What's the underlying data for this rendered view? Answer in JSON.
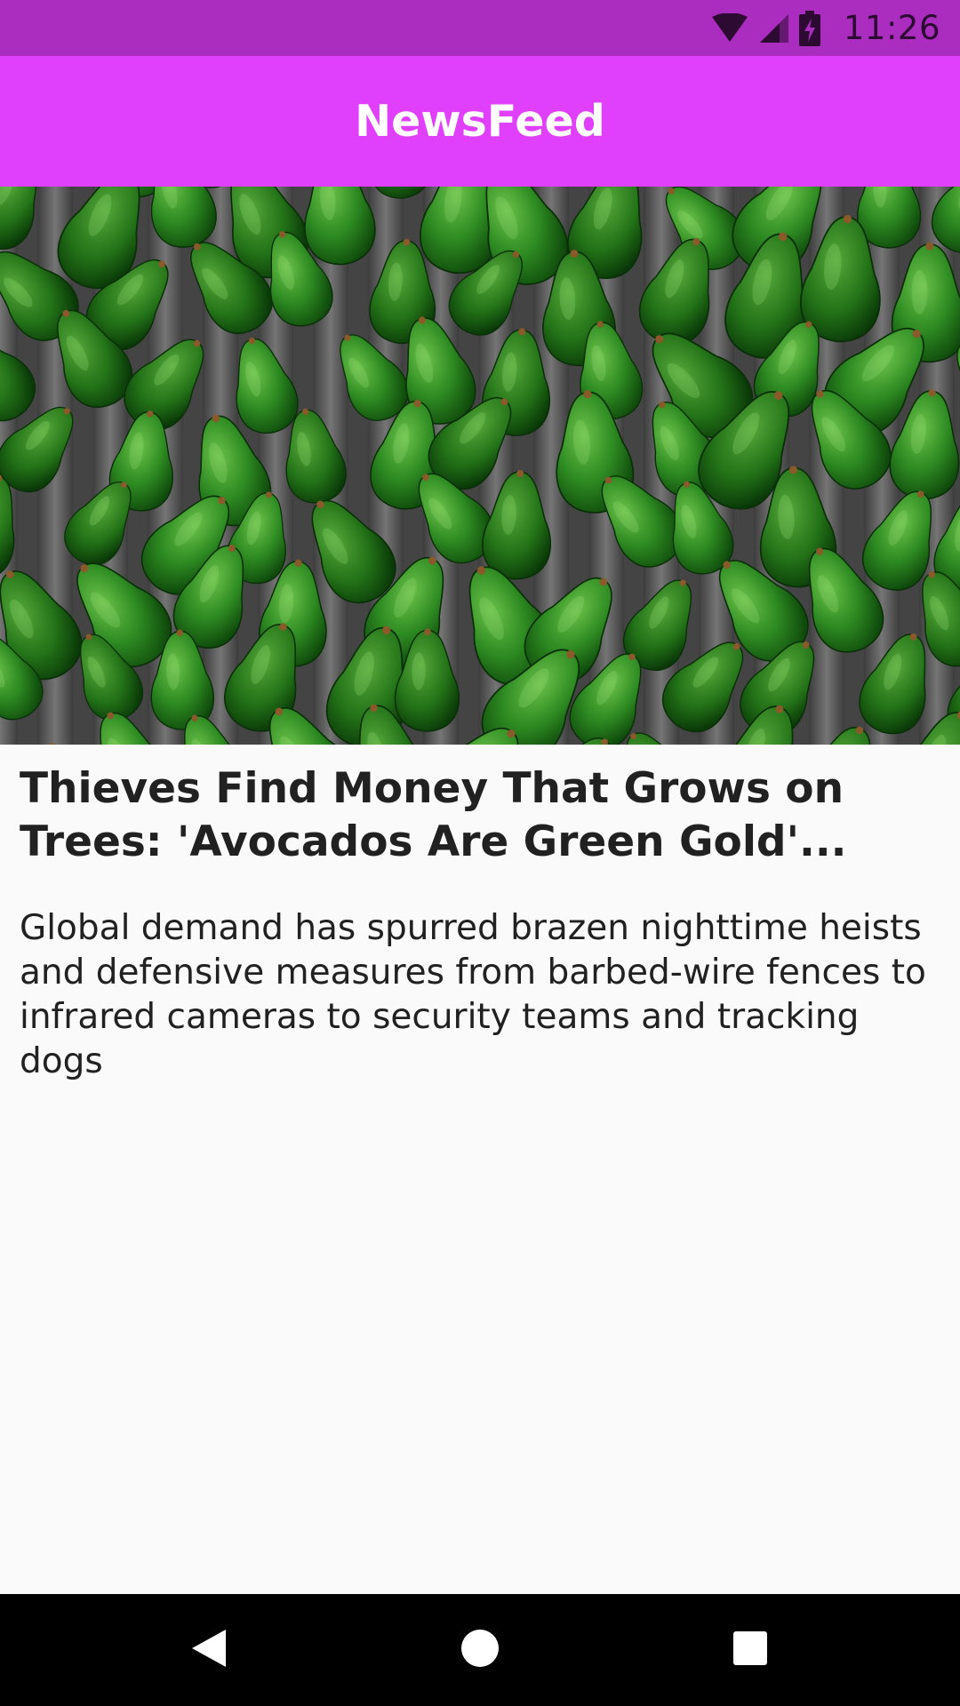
{
  "status_bar": {
    "time": "11:26",
    "icons": [
      "wifi-icon",
      "cellular-signal-icon",
      "battery-charging-icon"
    ]
  },
  "app_bar": {
    "title": "NewsFeed"
  },
  "article": {
    "image_subject": "avocados",
    "title": "Thieves Find Money That Grows on Trees: 'Avocados Are Green Gold'...",
    "description": "Global demand has spurred brazen nighttime heists and defensive measures from barbed-wire fences to infrared cameras to security teams and tracking dogs"
  },
  "nav_bar": {
    "buttons": [
      "back-icon",
      "home-icon",
      "recents-icon"
    ]
  },
  "colors": {
    "status_bar": "#ab2dbf",
    "app_bar": "#e040fb",
    "background": "#fafafa",
    "text": "#212121"
  }
}
